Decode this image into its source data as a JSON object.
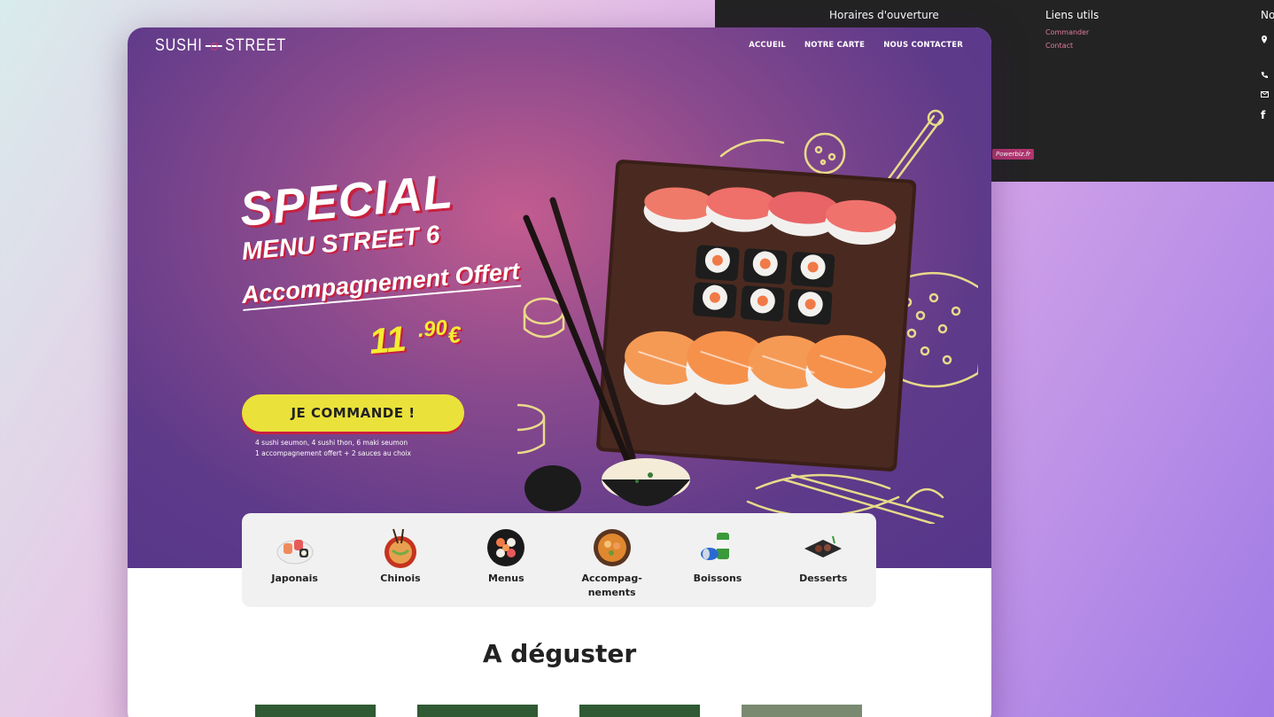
{
  "footer": {
    "hours_title": "Horaires d'ouverture",
    "links_title": "Liens utils",
    "links": [
      "Commander",
      "Contact"
    ],
    "third_title_partial": "No",
    "powered": "Powerbiz.fr"
  },
  "header": {
    "logo_left": "SUSHI",
    "logo_right": "STREET",
    "nav": [
      "ACCUEIL",
      "NOTRE CARTE",
      "NOUS CONTACTER"
    ]
  },
  "promo": {
    "line1": "SPECIAL",
    "line2": "MENU STREET 6",
    "line3": "Accompagnement Offert",
    "price_int": "11",
    "price_dec": ".90",
    "price_cur": "€",
    "cta": "JE COMMANDE !",
    "desc_line1": "4 sushi seumon, 4 sushi thon, 6 maki seumon",
    "desc_line2": "1 accompagnement offert + 2 sauces au choix"
  },
  "categories": [
    {
      "label": "Japonais"
    },
    {
      "label": "Chinois"
    },
    {
      "label": "Menus"
    },
    {
      "label": "Accompag-\nnements"
    },
    {
      "label": "Boissons"
    },
    {
      "label": "Desserts"
    }
  ],
  "section": {
    "title": "A déguster"
  }
}
